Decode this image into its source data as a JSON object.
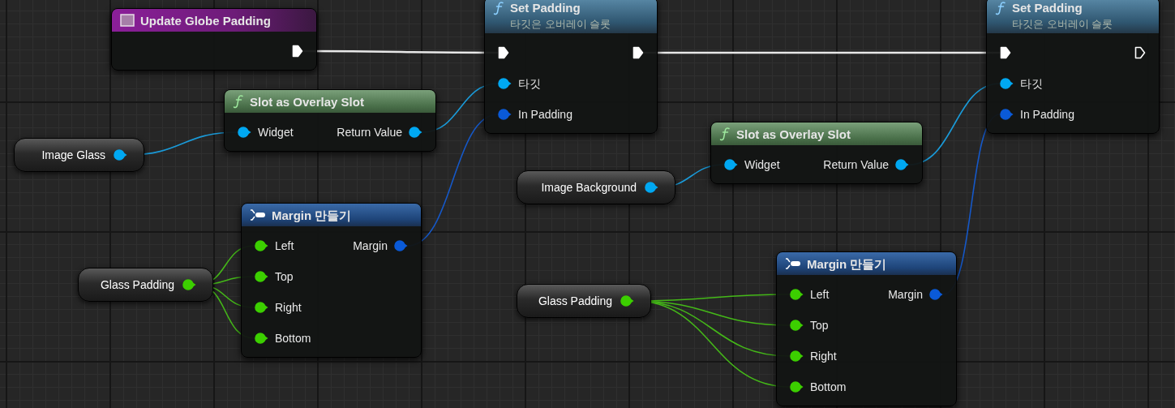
{
  "nodes": [
    {
      "kind": "event",
      "title": "Update Globe Padding",
      "outputs": [
        {
          "kind": "exec",
          "connected": true
        }
      ]
    },
    {
      "kind": "function",
      "title": "Set Padding",
      "subtitle": "타깃은 오버레이 슬롯",
      "inputs": [
        {
          "kind": "exec",
          "connected": true
        },
        {
          "kind": "object",
          "label": "타깃",
          "connected": true
        },
        {
          "kind": "struct",
          "label": "In Padding",
          "connected": true
        }
      ],
      "outputs": [
        {
          "kind": "exec",
          "connected": true
        }
      ]
    },
    {
      "kind": "function",
      "title": "Set Padding",
      "subtitle": "타깃은 오버레이 슬롯",
      "inputs": [
        {
          "kind": "exec",
          "connected": true
        },
        {
          "kind": "object",
          "label": "타깃",
          "connected": true
        },
        {
          "kind": "struct",
          "label": "In Padding",
          "connected": true
        }
      ],
      "outputs": [
        {
          "kind": "exec",
          "connected": false
        }
      ]
    },
    {
      "kind": "variable",
      "title": "Image Glass",
      "outputs": [
        {
          "kind": "object",
          "connected": true
        }
      ]
    },
    {
      "kind": "pure_function",
      "title": "Slot as Overlay Slot",
      "inputs": [
        {
          "kind": "object",
          "label": "Widget",
          "connected": true
        }
      ],
      "outputs": [
        {
          "kind": "object",
          "label": "Return Value",
          "connected": true
        }
      ]
    },
    {
      "kind": "variable",
      "title": "Image Background",
      "outputs": [
        {
          "kind": "object",
          "connected": true
        }
      ]
    },
    {
      "kind": "pure_function",
      "title": "Slot as Overlay Slot",
      "inputs": [
        {
          "kind": "object",
          "label": "Widget",
          "connected": true
        }
      ],
      "outputs": [
        {
          "kind": "object",
          "label": "Return Value",
          "connected": true
        }
      ]
    },
    {
      "kind": "variable",
      "title": "Glass Padding",
      "outputs": [
        {
          "kind": "float",
          "connected": true
        }
      ]
    },
    {
      "kind": "make_struct",
      "title": "Margin 만들기",
      "inputs": [
        {
          "kind": "float",
          "label": "Left",
          "connected": true
        },
        {
          "kind": "float",
          "label": "Top",
          "connected": true
        },
        {
          "kind": "float",
          "label": "Right",
          "connected": true
        },
        {
          "kind": "float",
          "label": "Bottom",
          "connected": true
        }
      ],
      "outputs": [
        {
          "kind": "struct",
          "label": "Margin",
          "connected": true
        }
      ]
    },
    {
      "kind": "variable",
      "title": "Glass Padding",
      "outputs": [
        {
          "kind": "float",
          "connected": true
        }
      ]
    },
    {
      "kind": "make_struct",
      "title": "Margin 만들기",
      "inputs": [
        {
          "kind": "float",
          "label": "Left",
          "connected": true
        },
        {
          "kind": "float",
          "label": "Top",
          "connected": true
        },
        {
          "kind": "float",
          "label": "Right",
          "connected": true
        },
        {
          "kind": "float",
          "label": "Bottom",
          "connected": true
        }
      ],
      "outputs": [
        {
          "kind": "struct",
          "label": "Margin",
          "connected": true
        }
      ]
    }
  ]
}
